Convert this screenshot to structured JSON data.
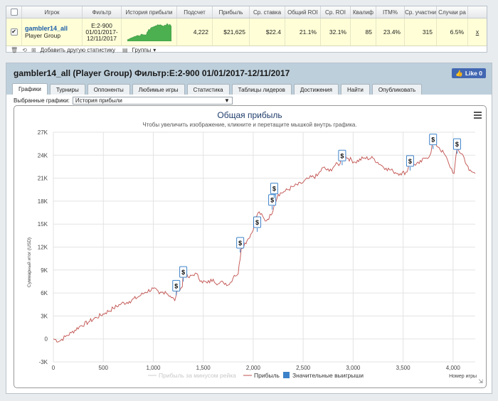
{
  "stats_table": {
    "headers": [
      "Игрок",
      "Фильтр",
      "История прибыли",
      "Подсчет",
      "Прибыль",
      "Ср. ставка",
      "Общий ROI",
      "Ср. ROI",
      "Квалиф",
      "ITM%",
      "Ср. участни",
      "Случаи ра"
    ],
    "row": {
      "checked": true,
      "player_name": "gambler14_all",
      "player_group": "Player Group",
      "filter_lines": [
        "E:2-900",
        "01/01/2017-",
        "12/11/2017"
      ],
      "count": "4,222",
      "profit": "$21,625",
      "avg_stake": "$22.4",
      "total_roi": "21.1%",
      "avg_roi": "32.1%",
      "qualif": "85",
      "itm": "23.4%",
      "avg_entrants": "315",
      "cases": "6.5%",
      "remove": "x"
    },
    "footer": {
      "add_stat": "Добавить другую статистику",
      "groups": "Группы"
    }
  },
  "panel": {
    "title": "gambler14_all (Player Group) Фильтр:E:2-900 01/01/2017-12/11/2017",
    "fb_like": "Like 0",
    "tabs": [
      "Графики",
      "Турниры",
      "Оппоненты",
      "Любимые игры",
      "Статистика",
      "Таблицы лидеров",
      "Достижения",
      "Найти",
      "Опубликовать"
    ],
    "active_tab": "Графики",
    "select_label": "Выбранные графики:",
    "select_value": "История прибыли"
  },
  "icons": {
    "trash": "trash-icon",
    "refresh": "refresh-icon",
    "add": "add-stat-icon",
    "groups": "groups-icon",
    "menu": "hamburger-menu-icon",
    "marker": "dollar-marker-icon"
  },
  "colors": {
    "profit_line": "#c0504d",
    "big_win_marker": "#3d82c9",
    "sparkline": "#4caf50"
  },
  "chart_data": {
    "type": "line",
    "title": "Общая прибыль",
    "subtitle": "Чтобы увеличить изображение, кликните и перетащите мышкой внутрь графика.",
    "xlabel": "Номер игры",
    "ylabel": "Суммарный итог (USD)",
    "xlim": [
      0,
      4222
    ],
    "ylim": [
      -3000,
      27000
    ],
    "xticks": [
      0,
      500,
      1000,
      1500,
      2000,
      2500,
      3000,
      3500,
      4000
    ],
    "xtick_labels": [
      "0",
      "500",
      "1,000",
      "1,500",
      "2,000",
      "2,500",
      "3,000",
      "3,500",
      "4,000"
    ],
    "yticks": [
      -3000,
      0,
      3000,
      6000,
      9000,
      12000,
      15000,
      18000,
      21000,
      24000,
      27000
    ],
    "ytick_labels": [
      "-3K",
      "0",
      "3K",
      "6K",
      "9K",
      "12K",
      "15K",
      "18K",
      "21K",
      "24K",
      "27K"
    ],
    "legend": [
      "Прибыль за минусом рейка",
      "Прибыль",
      "Значительные выигрыши"
    ],
    "series": [
      {
        "name": "Прибыль",
        "x": [
          0,
          60,
          120,
          180,
          260,
          350,
          430,
          520,
          600,
          680,
          760,
          850,
          920,
          1000,
          1060,
          1120,
          1170,
          1215,
          1240,
          1290,
          1300,
          1360,
          1420,
          1480,
          1540,
          1600,
          1650,
          1700,
          1760,
          1810,
          1850,
          1880,
          1940,
          2000,
          2010,
          2060,
          2120,
          2180,
          2210,
          2250,
          2320,
          2400,
          2480,
          2560,
          2640,
          2700,
          2760,
          2820,
          2870,
          2890,
          2950,
          3020,
          3100,
          3200,
          3280,
          3330,
          3400,
          3470,
          3540,
          3570,
          3600,
          3660,
          3720,
          3770,
          3800,
          3860,
          3920,
          3960,
          4010,
          4040,
          4100,
          4160,
          4222
        ],
        "y": [
          0,
          -300,
          300,
          800,
          1600,
          2200,
          2800,
          3400,
          4000,
          4600,
          4900,
          5500,
          6100,
          6600,
          5900,
          6200,
          5600,
          5000,
          6500,
          6800,
          8500,
          8000,
          8600,
          7600,
          7300,
          7800,
          7200,
          7400,
          7100,
          8300,
          8500,
          11800,
          12900,
          14200,
          15500,
          16600,
          15400,
          16200,
          17500,
          18900,
          19300,
          19900,
          20300,
          21000,
          21300,
          22400,
          21900,
          22700,
          22900,
          24100,
          23600,
          23100,
          23600,
          23600,
          22700,
          22300,
          21900,
          21600,
          21800,
          23500,
          22800,
          22900,
          23600,
          24000,
          25800,
          25000,
          24000,
          22800,
          21600,
          24800,
          24000,
          22000,
          21600
        ]
      }
    ],
    "big_wins": [
      {
        "x": 1230,
        "y": 5700
      },
      {
        "x": 1300,
        "y": 7500
      },
      {
        "x": 1870,
        "y": 11300
      },
      {
        "x": 2040,
        "y": 14000
      },
      {
        "x": 2190,
        "y": 16900
      },
      {
        "x": 2210,
        "y": 18400
      },
      {
        "x": 2890,
        "y": 22700
      },
      {
        "x": 3570,
        "y": 22000
      },
      {
        "x": 3800,
        "y": 24800
      },
      {
        "x": 4040,
        "y": 24200
      }
    ]
  }
}
